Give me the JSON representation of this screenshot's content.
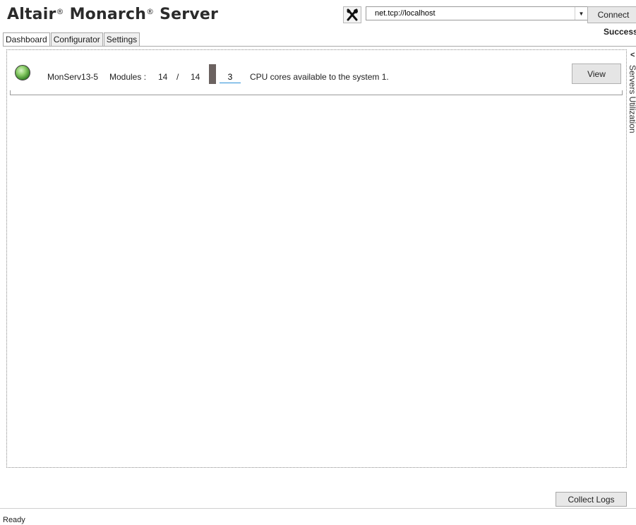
{
  "app": {
    "title_parts": [
      "Altair",
      "®",
      " Monarch",
      "®",
      " Server"
    ]
  },
  "toolbar": {
    "tools_icon": "tools-icon",
    "server_url": "net.tcp://localhost",
    "connect_label": "Connect",
    "connection_status": "Success"
  },
  "tabs": [
    {
      "label": "Dashboard",
      "active": true
    },
    {
      "label": "Configurator",
      "active": false
    },
    {
      "label": "Settings",
      "active": false
    }
  ],
  "server": {
    "status_color": "#5fae3e",
    "name": "MonServ13-5",
    "modules_label": "Modules :",
    "modules_available": "14",
    "separator": "/",
    "modules_total": "14",
    "cores_value": "3",
    "cores_text": "CPU cores available to the system 1.",
    "view_label": "View"
  },
  "side_panel": {
    "label": "Servers Utilization"
  },
  "footer": {
    "collect_logs_label": "Collect Logs"
  },
  "status_bar": {
    "text": "Ready"
  }
}
